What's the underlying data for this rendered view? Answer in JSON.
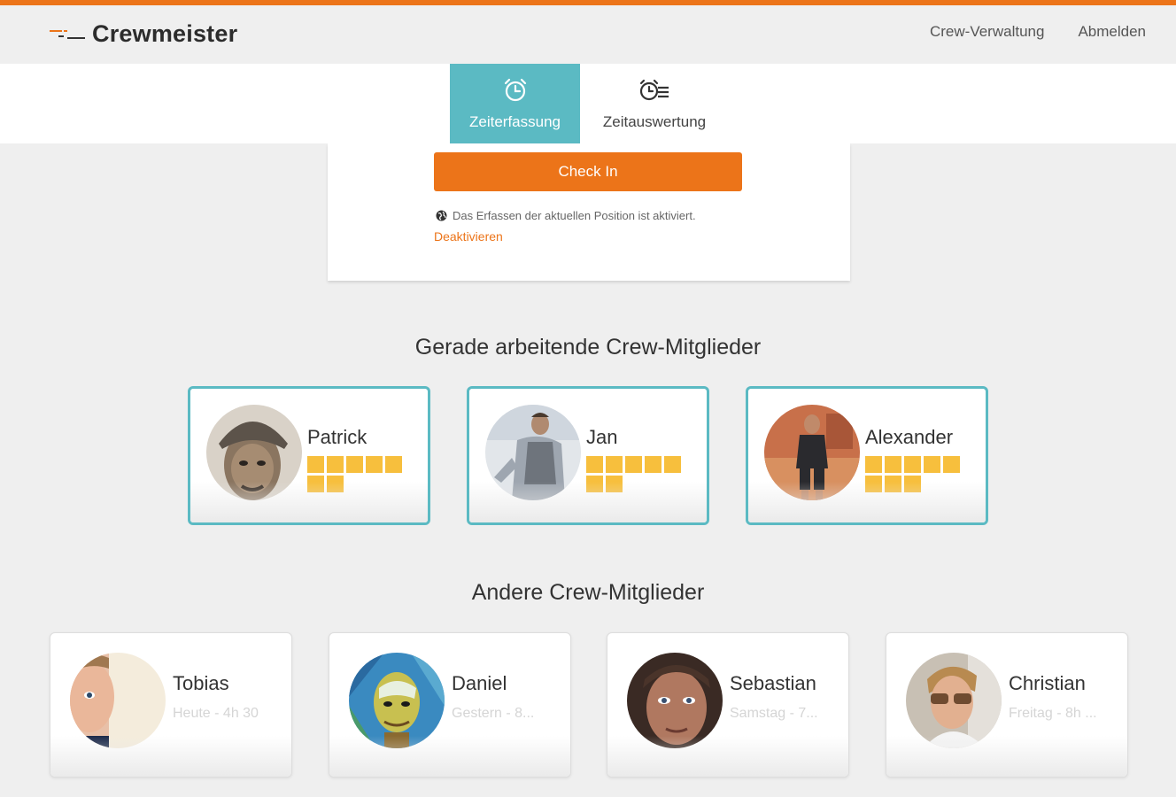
{
  "app": {
    "name": "Crewmeister",
    "accent": "#ec7419",
    "teal": "#5bbac3"
  },
  "nav": {
    "links": [
      "Crew-Verwaltung",
      "Abmelden"
    ]
  },
  "tabs": [
    {
      "label": "Zeiterfassung",
      "icon": "alarm-clock-icon",
      "active": true
    },
    {
      "label": "Zeitauswertung",
      "icon": "clock-list-icon",
      "active": false
    }
  ],
  "checkin": {
    "button_label": "Check In",
    "position_info": "Das Erfassen der aktuellen Position ist aktiviert.",
    "position_icon": "globe-icon",
    "deactivate_label": "Deaktivieren"
  },
  "working": {
    "title": "Gerade arbeitende Crew-Mitglieder",
    "members": [
      {
        "name": "Patrick",
        "blocks": 7
      },
      {
        "name": "Jan",
        "blocks": 7
      },
      {
        "name": "Alexander",
        "blocks": 8
      }
    ]
  },
  "others": {
    "title": "Andere Crew-Mitglieder",
    "members": [
      {
        "name": "Tobias",
        "last_seen": "Heute - 4h 30"
      },
      {
        "name": "Daniel",
        "last_seen": "Gestern - 8..."
      },
      {
        "name": "Sebastian",
        "last_seen": "Samstag - 7..."
      },
      {
        "name": "Christian",
        "last_seen": "Freitag - 8h ..."
      }
    ]
  }
}
